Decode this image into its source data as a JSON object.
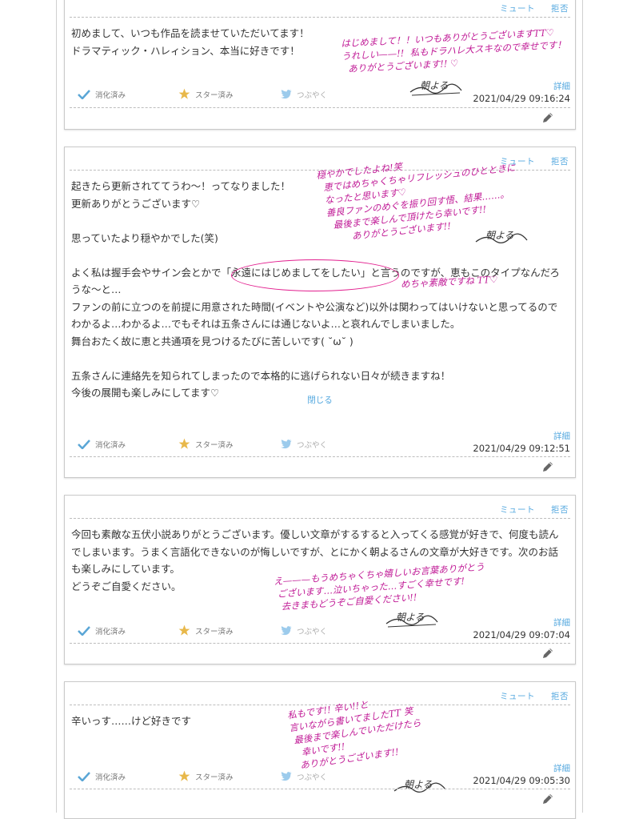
{
  "labels": {
    "mute": "ミュート",
    "reject": "拒否",
    "digested": "消化済み",
    "starred": "スター済み",
    "tweet": "つぶやく",
    "detail": "詳細",
    "close": "閉じる"
  },
  "colors": {
    "link": "#54a8df",
    "check": "#5aa6d6",
    "star": "#e8b84a",
    "handwriting": "#c01a96",
    "highlight_oval": "#e2208f"
  },
  "cards": [
    {
      "body": "初めまして、いつも作品を読ませていただいてます！\nドラマティック・ハレィション、本当に好きです！",
      "timestamp": "2021/04/29 09:16:24",
      "reply": "はじめまして！！いつもありがとうございますTT♡\nうれしい——!!  私もドラハレ大スキなので幸せです！\n  ありがとうございます!! ♡",
      "signature": "朝よる"
    },
    {
      "body": "起きたら更新されててうわ〜！ってなりました！\n更新ありがとうございます♡\n\n思っていたより穏やかでした(笑)\n\nよく私は握手会やサイン会とかで「永遠にはじめましてをしたい」と言うのですが、恵もこのタイプなんだろうな〜と…\nファンの前に立つのを前提に用意された時間(イベントや公演など)以外は関わってはいけないと思ってるのでわかるよ…わかるよ…でもそれは五条さんには通じないよ…と哀れんでしまいました。\n舞台おたく故に恵と共通項を見つけるたびに苦しいです( ˘ω˘ )\n\n五条さんに連絡先を知られてしまったので本格的に逃げられない日々が続きますね！\n今後の展開も楽しみにしてます♡",
      "timestamp": "2021/04/29 09:12:51",
      "reply": "穏やかでしたよね!笑\n  恵ではめちゃくちゃリフレッシュのひとときに\n  なったと思います♡\n  善良ファンのめぐを振り回す悟、結果……。\n    最後まで楽しんで頂けたら幸いです!!\n          ありがとうございます!!",
      "reply_note": "めちゃ素敵ですね TT♡",
      "signature": "朝よる"
    },
    {
      "body": "今回も素敵な五伏小説ありがとうございます。優しい文章がするすると入ってくる感覚が好きで、何度も読んでしまいます。うまく言語化できないのが悔しいですが、とにかく朝よるさんの文章が大好きです。次のお話も楽しみにしています。\nどうぞご自愛ください。",
      "timestamp": "2021/04/29 09:07:04",
      "reply": "え———もうめちゃくちゃ嬉しいお言葉ありがとう\n ございます…泣いちゃった…すごく幸せです!\n  去きまもどうぞご自愛ください!!",
      "signature": "朝よる"
    },
    {
      "body": "辛いっす……けど好きです",
      "timestamp": "2021/04/29 09:05:30",
      "reply": "私もです!! 辛い!!と\n言いながら書いてましたTT 笑\n 最後まで楽しんでいただけたら\n   幸いです!!\n  ありがとうございます!!",
      "signature": "朝よる"
    }
  ]
}
